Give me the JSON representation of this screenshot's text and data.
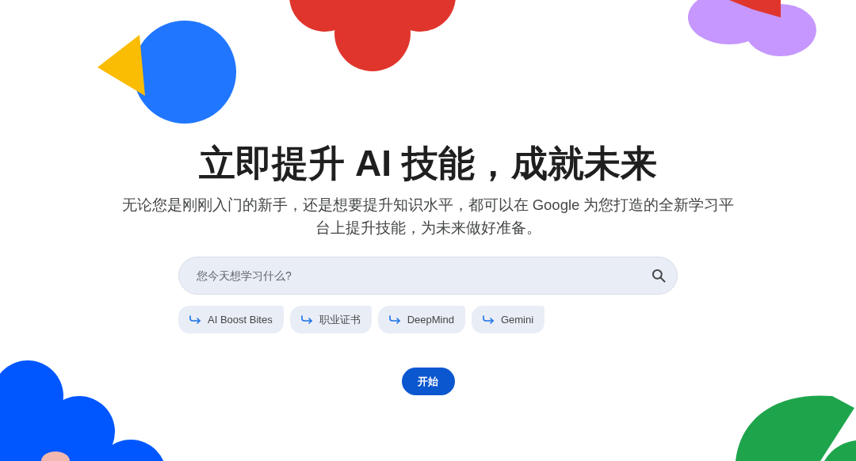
{
  "heading": "立即提升 AI 技能，成就未来",
  "subtitle": "无论您是刚刚入门的新手，还是想要提升知识水平，都可以在 Google 为您打造的全新学习平台上提升技能，为未来做好准备。",
  "search": {
    "placeholder": "您今天想学习什么?"
  },
  "chips": [
    {
      "label": "AI Boost Bites"
    },
    {
      "label": "职业证书"
    },
    {
      "label": "DeepMind"
    },
    {
      "label": "Gemini"
    }
  ],
  "start_button": "开始"
}
